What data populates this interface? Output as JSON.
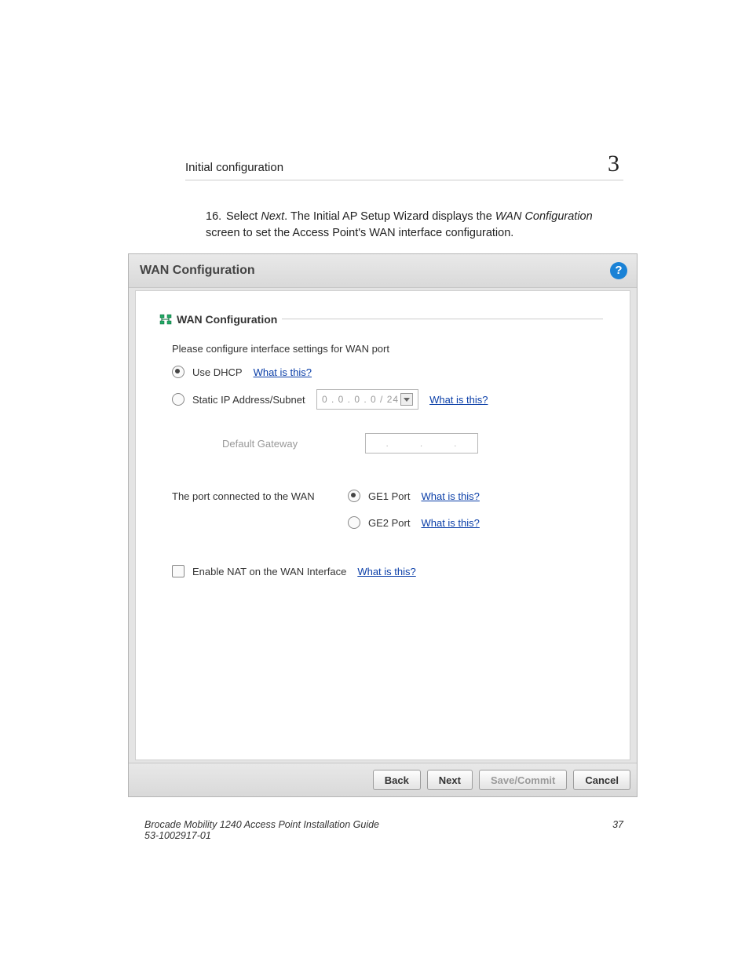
{
  "header": {
    "section": "Initial configuration",
    "chapter": "3"
  },
  "step": {
    "number": "16.",
    "pre": "Select ",
    "next_word": "Next",
    "post_next": ". The Initial AP Setup Wizard displays the ",
    "wan_conf": "WAN Configuration",
    "tail": " screen to set the Access Point's WAN interface configuration."
  },
  "window": {
    "title": "WAN Configuration",
    "help": "?"
  },
  "group": {
    "title": "WAN Configuration"
  },
  "form": {
    "prompt": "Please configure interface settings for WAN port",
    "dhcp": {
      "label": "Use DHCP",
      "help": "What is this?"
    },
    "static": {
      "label": "Static IP Address/Subnet",
      "ip": "0  .  0  .  0  .  0  /  24",
      "help": "What is this?"
    },
    "gateway": {
      "label": "Default Gateway"
    },
    "port_label": "The port connected to the WAN",
    "ge1": {
      "label": "GE1 Port",
      "help": "What is this?"
    },
    "ge2": {
      "label": "GE2 Port",
      "help": "What is this?"
    },
    "nat": {
      "label": "Enable NAT on the WAN Interface",
      "help": "What is this?"
    }
  },
  "buttons": {
    "back": "Back",
    "next": "Next",
    "save": "Save/Commit",
    "cancel": "Cancel"
  },
  "footer": {
    "line1": "Brocade Mobility 1240 Access Point Installation Guide",
    "line2": "53-1002917-01",
    "page": "37"
  }
}
